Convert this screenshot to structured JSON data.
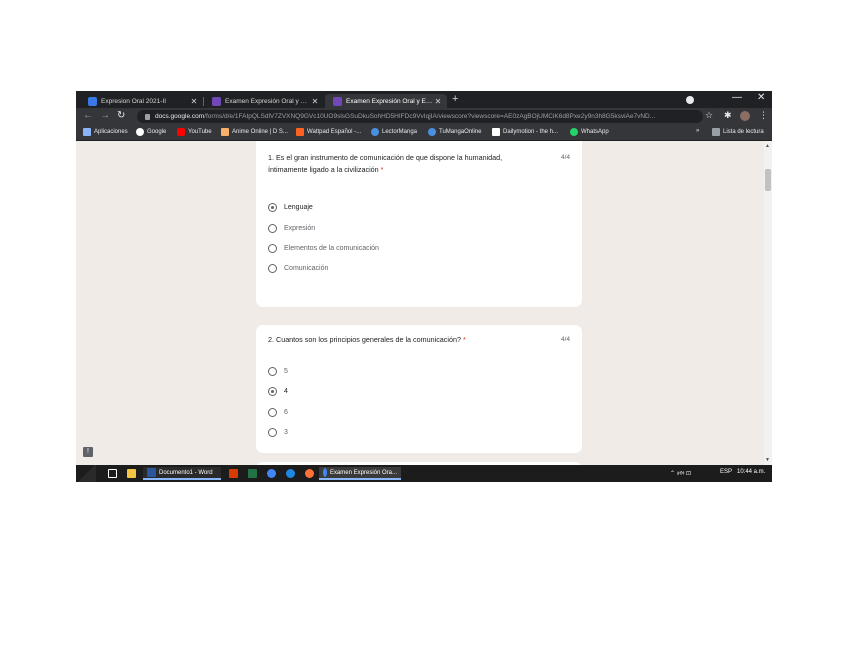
{
  "browser": {
    "tabs": [
      {
        "label": "Expresion Oral 2021-II",
        "close": "✕",
        "color": "#3b78e7"
      },
      {
        "label": "Examen Expresión Oral y Escrita",
        "close": "✕",
        "color": "#7248b9"
      },
      {
        "label": "Examen Expresión Oral y Escrita",
        "close": "✕",
        "color": "#7248b9"
      }
    ],
    "new_tab": "+",
    "window_controls": {
      "minimize": "—",
      "close": "✕"
    },
    "nav": {
      "back": "←",
      "forward": "→",
      "reload": "↻"
    },
    "url_domain": "docs.google.com",
    "url_path": "/forms/d/e/1FAIpQLSdlV7ZVXNQ9GVc10UO9slsGSuDkuSohHD5HIFDc9VvIqjIA/viewscore?viewscore=AE0zAgBOjUMCiK6d8Pxe2y9n3h8G5ksviAe7vND...",
    "toolbar_icons": {
      "star": "☆",
      "extensions": "✱",
      "menu": "⋮"
    },
    "bookmarks": [
      {
        "label": "Aplicaciones",
        "icon": "apps-icon",
        "color": "#8ab4f8"
      },
      {
        "label": "Google",
        "icon": "google-icon",
        "color": "#ffffff"
      },
      {
        "label": "YouTube",
        "icon": "youtube-icon",
        "color": "#ff0000"
      },
      {
        "label": "Anime Online | D S...",
        "icon": "anime-icon",
        "color": "#f6b26b"
      },
      {
        "label": "Wattpad Español -...",
        "icon": "wattpad-icon",
        "color": "#ff6122"
      },
      {
        "label": "LectorManga",
        "icon": "lectormanga-icon",
        "color": "#4a90e2"
      },
      {
        "label": "TuMangaOnline",
        "icon": "tumanga-icon",
        "color": "#4a90e2"
      },
      {
        "label": "Dailymotion - the h...",
        "icon": "dailymotion-icon",
        "color": "#ffffff"
      },
      {
        "label": "WhatsApp",
        "icon": "whatsapp-icon",
        "color": "#25d366"
      }
    ],
    "bookmarks_more": "»",
    "reading_list": "Lista de lectura"
  },
  "form": {
    "questions": [
      {
        "number": "1.",
        "text": "Es el gran instrumento de comunicación de que dispone la humanidad, íntimamente ligado a la civilización",
        "required": "*",
        "score": "4/4",
        "options": [
          {
            "label": "Lenguaje",
            "selected": true
          },
          {
            "label": "Expresión",
            "selected": false
          },
          {
            "label": "Elementos de la comunicación",
            "selected": false
          },
          {
            "label": "Comunicación",
            "selected": false
          }
        ]
      },
      {
        "number": "2.",
        "text": "Cuantos son los principios generales de la comunicación?",
        "required": "*",
        "score": "4/4",
        "options": [
          {
            "label": "5",
            "selected": false
          },
          {
            "label": "4",
            "selected": true
          },
          {
            "label": "6",
            "selected": false
          },
          {
            "label": "3",
            "selected": false
          }
        ]
      }
    ],
    "feedback_icon": "!"
  },
  "taskbar": {
    "apps": [
      {
        "label": "Documento1 - Word",
        "color": "#2b579a"
      },
      {
        "label": "Examen Expresión Ora...",
        "color": "#7248b9"
      }
    ],
    "tray": {
      "icons": "⌃ 🕬 ⊡",
      "lang": "ESP",
      "time": "10:44 a.m."
    }
  }
}
